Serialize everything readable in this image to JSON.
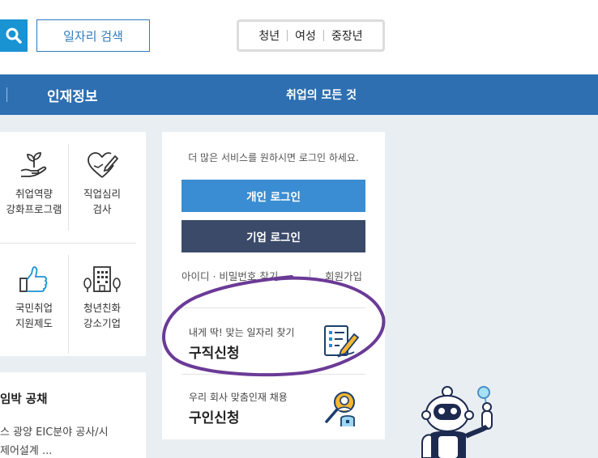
{
  "header": {
    "search_icon": "search-icon",
    "job_search_label": "일자리 검색",
    "target_tabs": [
      "청년",
      "여성",
      "중장년"
    ]
  },
  "nav": {
    "talent_info": "인재정보",
    "all_about_jobs": "취업의 모든 것"
  },
  "menu": {
    "items": [
      {
        "icon": "sprout-hand-icon",
        "label": "취업역량\n강화프로그램"
      },
      {
        "icon": "heart-pen-icon",
        "label": "직업심리\n검사"
      },
      {
        "icon": "thumbs-up-icon",
        "label": "국민취업\n지원제도"
      },
      {
        "icon": "building-trees-icon",
        "label": "청년친화\n강소기업"
      }
    ]
  },
  "recruit": {
    "title": "임박 공채",
    "line1": "스  광양 EIC분야 공사/시",
    "line2": "제어설계 ..."
  },
  "login": {
    "notice": "더 많은 서비스를 원하시면 로그인 하세요.",
    "personal_login": "개인 로그인",
    "company_login": "기업 로그인",
    "find_id_pw": "아이디 · 비밀번호 찾기",
    "join": "회원가입"
  },
  "services": [
    {
      "sub": "내게 딱! 맞는 일자리 찾기",
      "main": "구직신청",
      "icon": "resume-pen-icon"
    },
    {
      "sub": "우리 회사 맞춤인재 채용",
      "main": "구인신청",
      "icon": "person-magnifier-icon"
    }
  ],
  "colors": {
    "nav_blue": "#2d6fb1",
    "personal_login_blue": "#3a8dd2",
    "company_login_navy": "#3b4a69",
    "annotation_purple": "#6b3a96",
    "background_gray": "#e9eef3"
  }
}
